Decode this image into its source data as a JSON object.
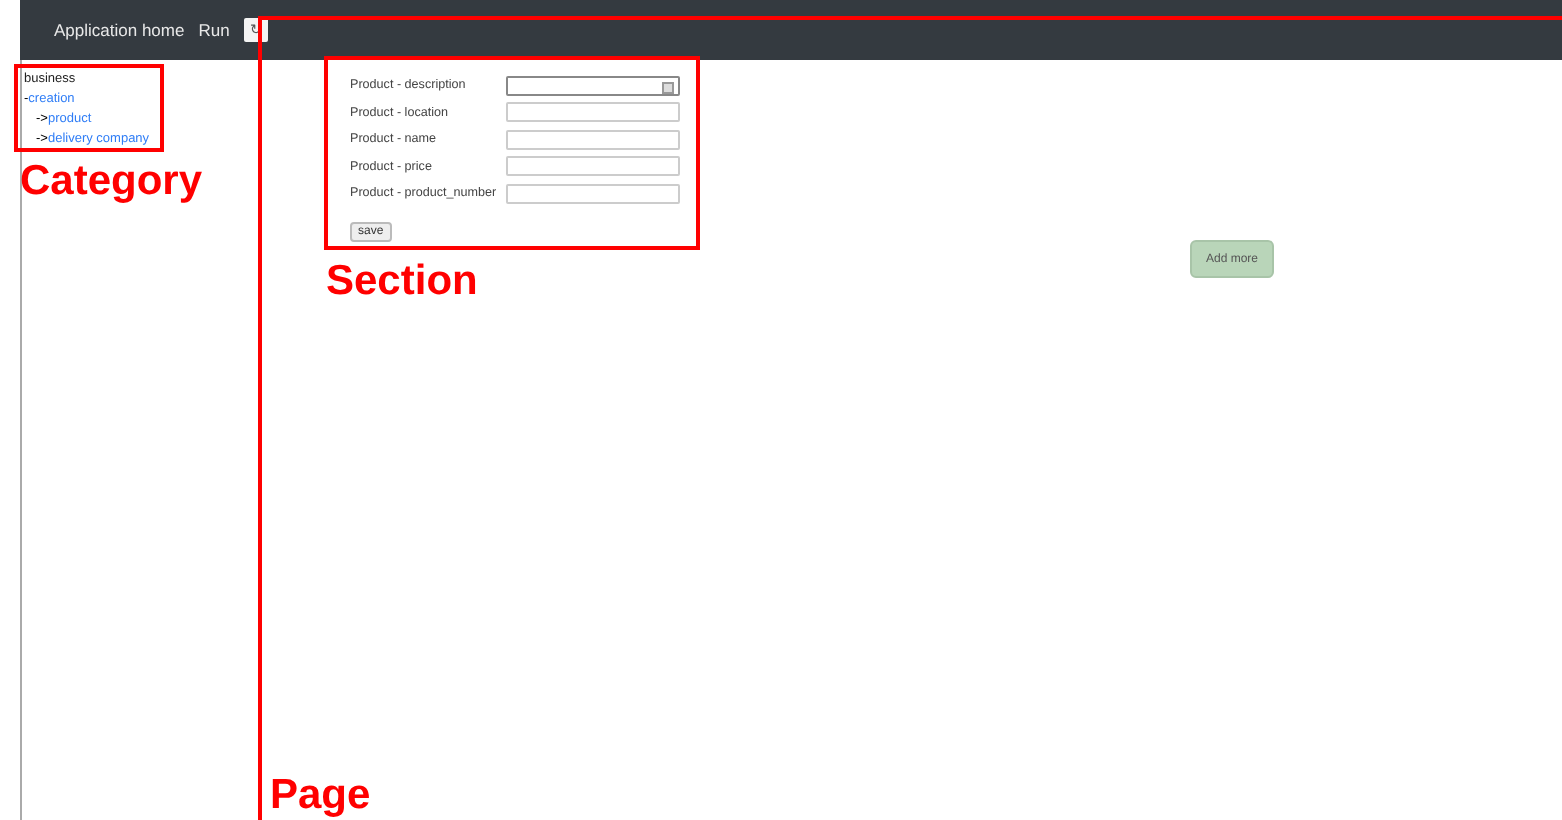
{
  "topbar": {
    "title": "Application home",
    "run": "Run",
    "icon_button": "↻"
  },
  "tree": [
    {
      "label": "business",
      "link": false,
      "children": [
        {
          "prefix": "-",
          "label": "creation",
          "link": true,
          "children": [
            {
              "prefix": "->",
              "label": "product",
              "link": true
            },
            {
              "prefix": "->",
              "label": "delivery company",
              "link": true
            }
          ]
        }
      ]
    }
  ],
  "form": {
    "fields": [
      {
        "label": "Product - description",
        "kind": "textarea"
      },
      {
        "label": "Product - location",
        "kind": "text"
      },
      {
        "label": "Product - name",
        "kind": "text"
      },
      {
        "label": "Product - price",
        "kind": "text"
      },
      {
        "label": "Product - product_number",
        "kind": "text"
      }
    ],
    "save": "save"
  },
  "add_more": "Add more",
  "annotations": [
    {
      "label": "Category"
    },
    {
      "label": "Section"
    },
    {
      "label": "Page"
    }
  ]
}
